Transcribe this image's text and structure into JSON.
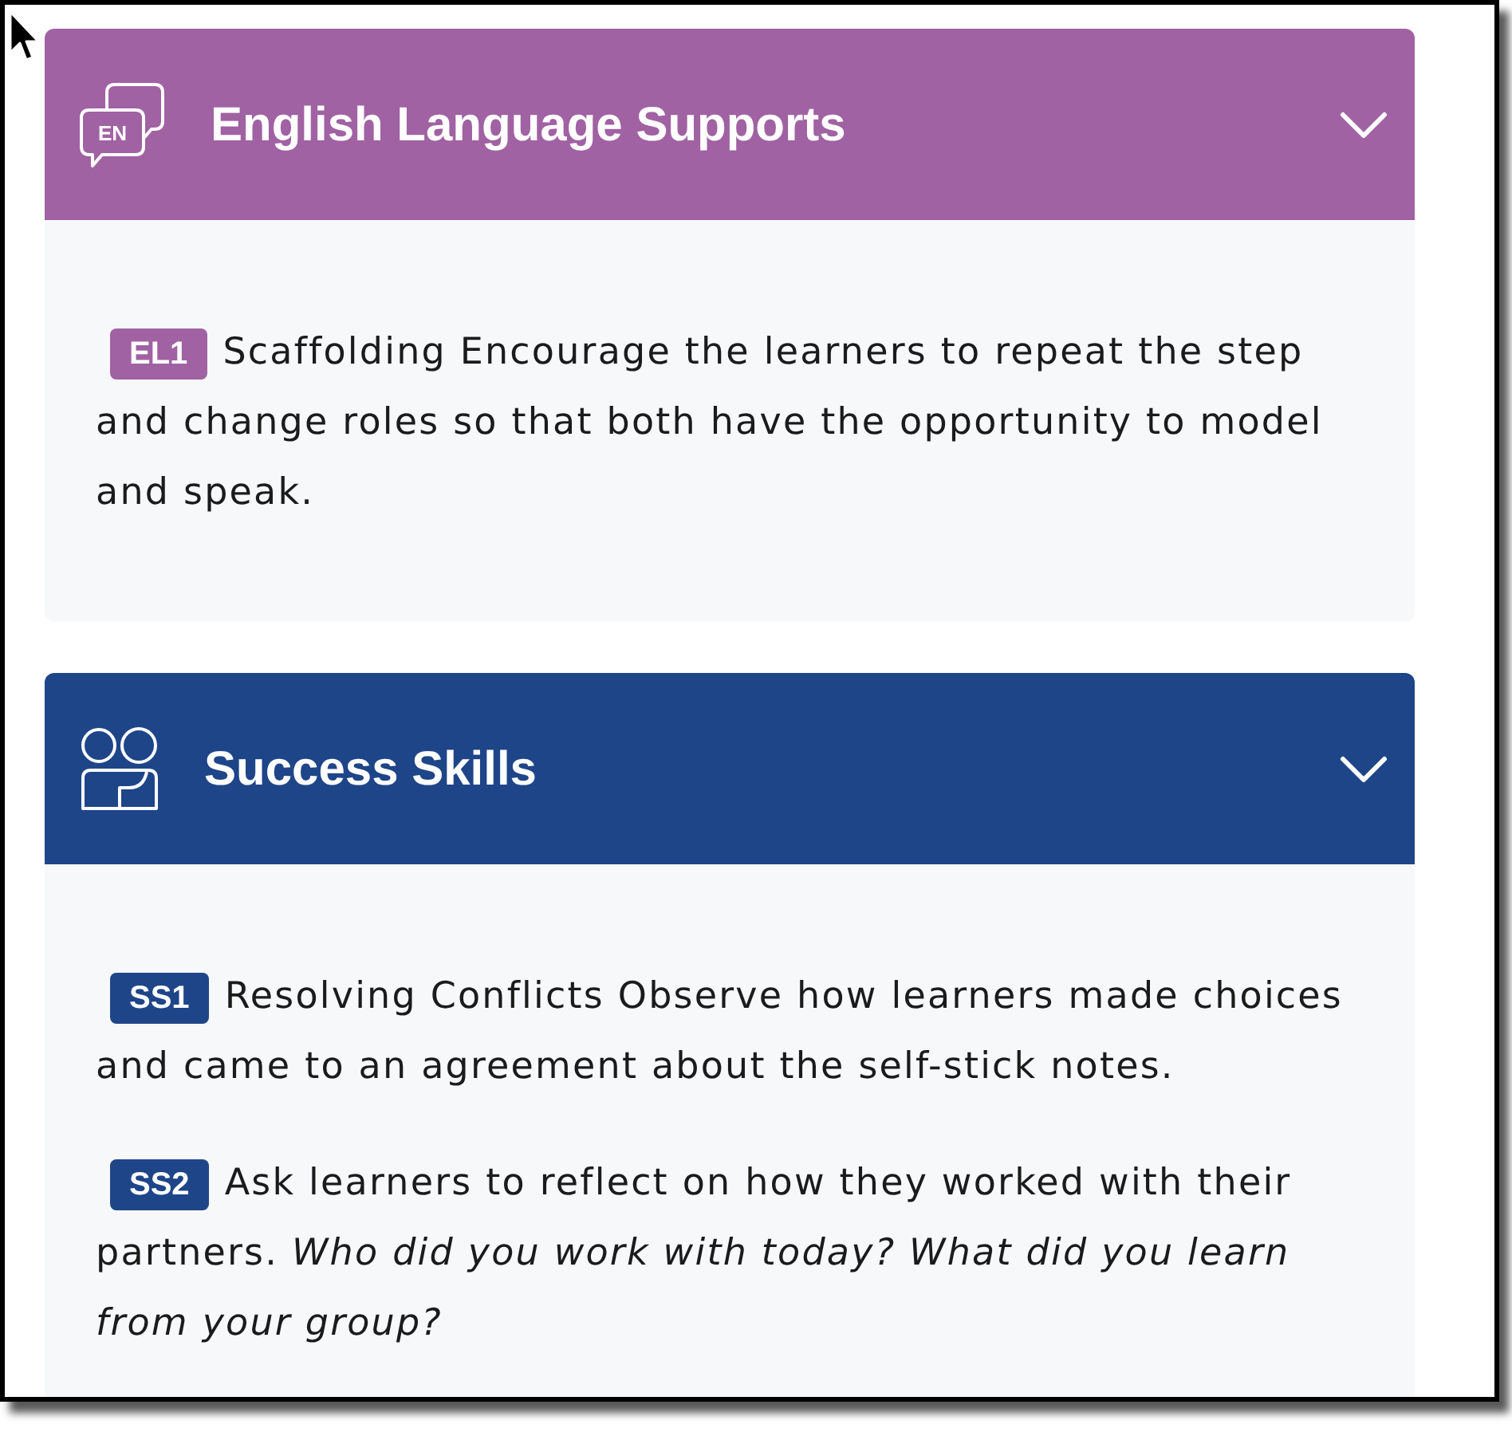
{
  "panels": [
    {
      "kind": "english-language",
      "icon_label": "EN",
      "title": "English Language Supports",
      "color": "#a062a3",
      "expanded": true,
      "notes": [
        {
          "code": "EL1",
          "text": "Scaffolding Encourage the learners to repeat the step and change roles so that both have the opportunity to model and speak."
        }
      ]
    },
    {
      "kind": "success-skills",
      "title": "Success Skills",
      "color": "#1f4589",
      "expanded": true,
      "notes": [
        {
          "code": "SS1",
          "text": "Resolving Conflicts Observe how learners made choices and came to an agreement about the self-stick notes."
        },
        {
          "code": "SS2",
          "text": "Ask learners to reflect on how they worked with their partners. *Who did you work with today? What did you learn from your group?*"
        }
      ]
    }
  ]
}
